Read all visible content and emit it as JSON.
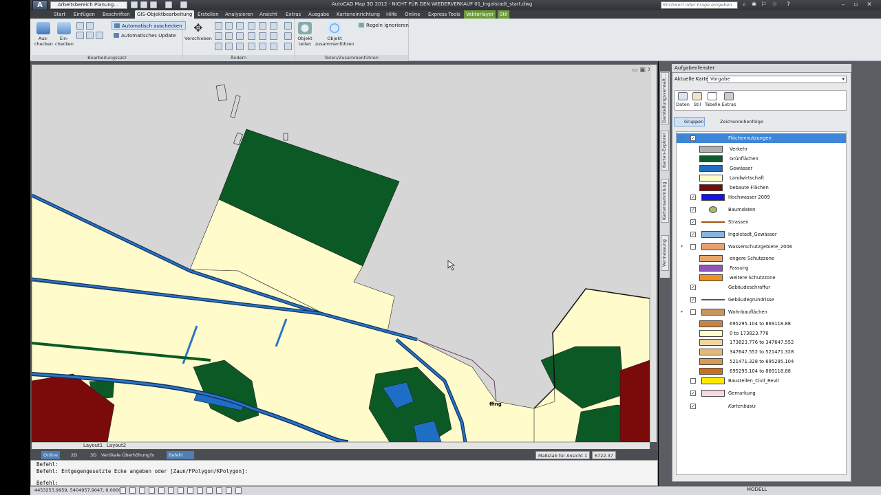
{
  "titlebar": {
    "app_button": "A",
    "workspace": "Arbeitsbereich Planung...",
    "title": "AutoCAD Map 3D 2012 - NICHT FÜR DEN WIEDERVERKAUF    01_Ingolstadt_start.dwg",
    "search_placeholder": "Stichwort oder Frage eingeben"
  },
  "ribbon_tabs": [
    "Start",
    "Einfügen",
    "Beschriften",
    "GIS-Objektbearbeitung",
    "Erstellen",
    "Analysieren",
    "Ansicht",
    "Extras",
    "Ausgabe",
    "Karteneinrichtung",
    "Hilfe",
    "Online",
    "Express Tools",
    "Vektorlayer",
    "Stil"
  ],
  "ribbon": {
    "auschecken": "Aus-\nchecken",
    "einchecken": "Ein-\nchecken",
    "auto_auschecken": "Automatisch auschecken",
    "auto_update": "Automatisches Update",
    "panel1": "Bearbeitungssatz",
    "verschieben": "Verschieben",
    "panel2": "Ändern",
    "objekt_teilen": "Objekt\nteilen",
    "objekt_zusammen": "Objekt\nzusammenführen",
    "regeln": "Regeln ignorieren",
    "panel3": "Teilen/Zusammenführen"
  },
  "drawing": {
    "label_text": "ffing",
    "layout_tabs": [
      "Layout1",
      "Layout2"
    ]
  },
  "statusbar": {
    "online": "Online",
    "twod": "2D",
    "threed": "3D",
    "vert": "Vertikale Überhöhung",
    "fx": "fx",
    "befehl": "Befehl",
    "massstab": "Maßstab für Ansicht 1",
    "scale_value": "6722.37"
  },
  "command": {
    "lines": [
      "Befehl:",
      "Befehl: Entgegengesetzte Ecke angeben oder [Zaun/FPolygon/KPolygon]:",
      "",
      "Befehl:"
    ]
  },
  "coords": "4453253.9959, 5404957.9047, 0.0000",
  "modell": "MODELL",
  "taskpane": {
    "title": "Aufgabenfenster",
    "side_tabs": [
      "Darstellungsverwalt...",
      "Karten-Explorer",
      "Kartensammlung",
      "Vermessung"
    ],
    "current_map_label": "Aktuelle Karte",
    "current_map": "Vorgabe",
    "tools": [
      "Daten",
      "Stil",
      "Tabelle",
      "Extras"
    ],
    "gruppen": "Gruppen",
    "draw_order": "Zeichenreihenfolge"
  },
  "layers": [
    {
      "name": "Flächennutzungen",
      "checked": true,
      "expanded": true,
      "selected": true
    },
    {
      "name": "Verkehr",
      "sub": true,
      "color": "#b0b0b0"
    },
    {
      "name": "Grünflächen",
      "sub": true,
      "color": "#0d5a2a"
    },
    {
      "name": "Gewässer",
      "sub": true,
      "color": "#1f6fc0"
    },
    {
      "name": "Landwirtschaft",
      "sub": true,
      "color": "#fffccc"
    },
    {
      "name": "bebaute Flächen",
      "sub": true,
      "color": "#7a0a0a"
    },
    {
      "name": "Hochwasser 2009",
      "checked": true,
      "color": "#1515e6"
    },
    {
      "name": "Baumdaten",
      "checked": true,
      "color": "#9fbf6a"
    },
    {
      "name": "Strassen",
      "checked": true,
      "color": "#a0520f"
    },
    {
      "name": "Ingolstadt_Gewässer",
      "checked": true,
      "color": "#84b6e0"
    },
    {
      "name": "Wasserschutzgebiete_2006",
      "checked": false,
      "expanded": true,
      "color": "#e8a070"
    },
    {
      "name": "engere Schutzzone",
      "sub": true,
      "color": "#e8a86a"
    },
    {
      "name": "Fassung",
      "sub": true,
      "color": "#8f58b7"
    },
    {
      "name": "weitere Schutzzone",
      "sub": true,
      "color": "#f0901e"
    },
    {
      "name": "Gebäudeschraffur",
      "checked": true
    },
    {
      "name": "Gebäudegrundrisse",
      "checked": true,
      "color": "#555555"
    },
    {
      "name": "Wohnbauflächen",
      "checked": false,
      "expanded": true,
      "color": "#c99460"
    },
    {
      "name": "695295.104 to 869118.88",
      "sub": true,
      "color": "#c8843c"
    },
    {
      "name": "0 to 173823.776",
      "sub": true,
      "color": "#fffccc"
    },
    {
      "name": "173823.776 to 347647.552",
      "sub": true,
      "color": "#f0d5a0"
    },
    {
      "name": "347647.552 to 521471.328",
      "sub": true,
      "color": "#e6b878"
    },
    {
      "name": "521471.328 to 695295.104",
      "sub": true,
      "color": "#d89a50"
    },
    {
      "name": "695295.104 to 869118.88",
      "sub": true,
      "color": "#c8701e"
    },
    {
      "name": "Baustellen_Civil_Revit",
      "checked": false,
      "color": "#ffea00"
    },
    {
      "name": "Gemarkung",
      "checked": true,
      "color": "#f8d8e0"
    },
    {
      "name": "Kartenbasis",
      "checked": true,
      "italic": true
    }
  ],
  "colors": {
    "gruen": "#0b5a26",
    "land": "#fffbcb",
    "wasser": "#1d6ec4",
    "bebaut": "#7b0a0a",
    "verkehr": "#d5d5d5"
  }
}
